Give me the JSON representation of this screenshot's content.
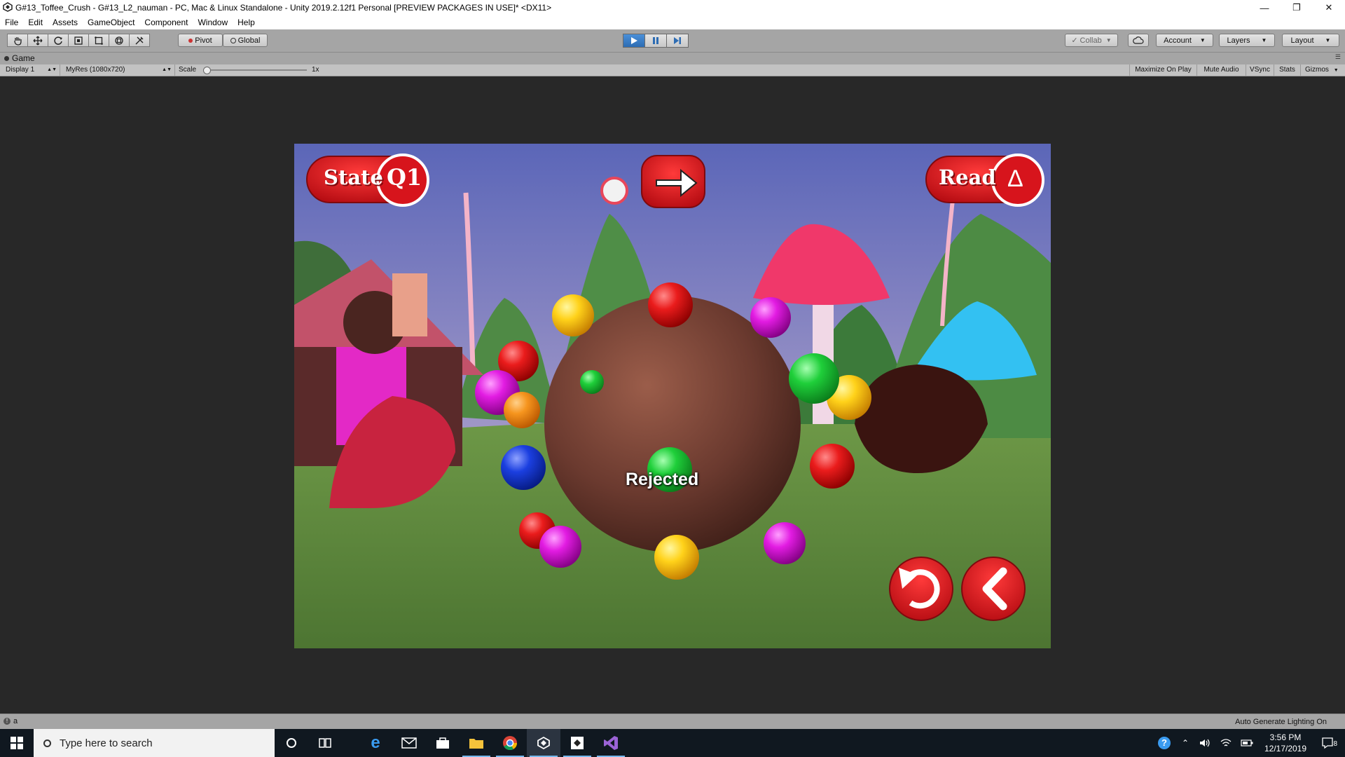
{
  "window": {
    "title": "G#13_Toffee_Crush - G#13_L2_nauman - PC, Mac & Linux Standalone - Unity 2019.2.12f1 Personal [PREVIEW PACKAGES IN USE]* <DX11>",
    "controls": [
      "minimize-icon",
      "restore-icon",
      "close-icon"
    ]
  },
  "menu": [
    "File",
    "Edit",
    "Assets",
    "GameObject",
    "Component",
    "Window",
    "Help"
  ],
  "toolbar": {
    "tools": [
      "hand-tool-icon",
      "move-tool-icon",
      "rotate-tool-icon",
      "scale-tool-icon",
      "rect-tool-icon",
      "transform-tool-icon",
      "custom-tool-icon"
    ],
    "pivot": "Pivot",
    "global": "Global",
    "playback": [
      "play-icon",
      "pause-icon",
      "step-icon"
    ],
    "play_active": true,
    "collab": "Collab",
    "account": "Account",
    "layers": "Layers",
    "layout": "Layout"
  },
  "game_view": {
    "tab": "Game",
    "display": "Display 1",
    "resolution": "MyRes (1080x720)",
    "scale_label": "Scale",
    "scale_value": "1x",
    "scale_level": 0,
    "options": [
      "Maximize On Play",
      "Mute Audio",
      "VSync",
      "Stats",
      "Gizmos"
    ]
  },
  "game": {
    "state_button": "State",
    "read_button": "Read",
    "status_text": "Rejected",
    "state_symbol": "Q1",
    "read_symbol": "Δ",
    "colors": {
      "button_red": "#d7141c",
      "sky": "#8a89c2",
      "ground": "#5f8a3f",
      "ball_brown": "#6b3a2f"
    }
  },
  "statusbar": {
    "left": "a",
    "right": "Auto Generate Lighting On"
  },
  "taskbar": {
    "search_placeholder": "Type here to search",
    "apps": [
      "cortana-icon",
      "task-view-icon",
      "edge-icon",
      "mail-icon",
      "store-icon",
      "file-explorer-icon",
      "chrome-icon",
      "unity-icon",
      "unity-hub-icon",
      "visual-studio-icon"
    ],
    "time": "3:56 PM",
    "date": "12/17/2019",
    "notifications": "8"
  }
}
